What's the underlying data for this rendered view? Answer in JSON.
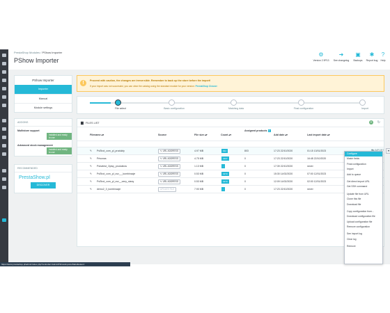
{
  "breadcrumb": {
    "parent": "PrestaShop Modules",
    "separator": "/",
    "current": "PShow Importer"
  },
  "page_title": "PShow Importer",
  "toolbar": [
    {
      "label": "Version 2.9P13",
      "icon": "gears-icon"
    },
    {
      "label": "See changelog",
      "icon": "arrow-circle-icon"
    },
    {
      "label": "Backups",
      "icon": "save-icon"
    },
    {
      "label": "Report bug",
      "icon": "bug-icon"
    },
    {
      "label": "Help",
      "icon": "help-icon"
    }
  ],
  "left_nav": {
    "title": "PShow Importer",
    "items": [
      "Importer",
      "Manual",
      "Module settings"
    ]
  },
  "addons": {
    "title": "ADDONS",
    "items": [
      {
        "name": "Multistore support",
        "badge": "installed and ready to use"
      },
      {
        "name": "Advanced stock management",
        "badge": "installed and ready to use"
      }
    ]
  },
  "recommended": {
    "title": "RECOMMENDED",
    "logo": "PrestaShow.pl",
    "button": "DISCOVER"
  },
  "warning": {
    "line1": "Proceed with caution, the changes are irreversible. Remember to back up the store before the import!",
    "line2": "If your import was not successful, you can clear the catalog using the standard module for your version:",
    "link": "PrestaShop Cleaner"
  },
  "steps": [
    "File select",
    "Basic configuration",
    "Matching data",
    "Final configuration",
    "Import"
  ],
  "files": {
    "title": "FILES LIST",
    "columns": {
      "filename": "Filename",
      "source": "Source",
      "file_size": "File size",
      "count": "Count",
      "assigned": "Assigned products",
      "assigned_badge": "1",
      "add_date": "Add date",
      "last_import": "Last import date"
    },
    "rows": [
      {
        "name": "PsShot_com_pl_produkty",
        "source": "URL ADDRESS",
        "size": "4.97 MB",
        "count": "842",
        "assigned": "803",
        "add_date": "17:23 22/10/2020",
        "last": "01:15 13/01/2023",
        "action": "IMPORT"
      },
      {
        "name": "Prisonas",
        "source": "URL ADDRESS",
        "size": "4.75 MB",
        "count": "3407",
        "assigned": "0",
        "add_date": "17:23 22/10/2020",
        "last": "16:48 22/10/2020",
        "action": ""
      },
      {
        "name": "Pshwlest_Opisy_produktow",
        "source": "URL ADDRESS",
        "size": "1.13 MB",
        "count": "-",
        "assigned": "0",
        "add_date": "17:39 22/10/2020",
        "last": "never",
        "action": ""
      },
      {
        "name": "PsShot_com_pl_csv___kombinacje",
        "source": "URL ADDRESS",
        "size": "0.53 MB",
        "count": "3273",
        "assigned": "0",
        "add_date": "15:30 14/02/2020",
        "last": "07:00 12/01/2023",
        "action": ""
      },
      {
        "name": "PsShot_com_pl_csv__ceny_stany",
        "source": "URL ADDRESS",
        "size": "0.53 MB",
        "count": "3273",
        "assigned": "0",
        "add_date": "12:09 14/02/2020",
        "last": "02:00 12/01/2023",
        "action": ""
      },
      {
        "name": "demo2_3_kombinacje",
        "source": "UPDATE FILE",
        "size": "7.90 MB",
        "count": "-",
        "assigned": "0",
        "add_date": "17:23 22/10/2020",
        "last": "never",
        "action": ""
      }
    ]
  },
  "dropdown": [
    "Configure",
    "Match fields",
    "Final configuration",
    "Import",
    "Add to queue",
    "Get direct import URL",
    "Get SSH command",
    "Update file from URL",
    "Clone this file",
    "Download file",
    "Copy configuration from...",
    "Download configuration file",
    "Upload configuration file",
    "Remove configuration",
    "See import log",
    "Clear log",
    "Remove"
  ],
  "status_url": "https://www.prestashop.pl/admin/index.php?controller=AdminPShowImporterMain&token="
}
